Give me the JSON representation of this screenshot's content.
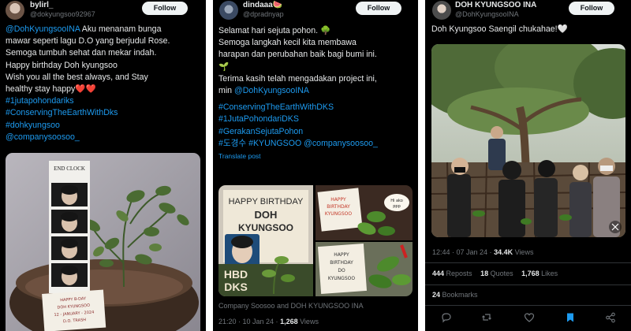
{
  "post1": {
    "display_name": "bylirl_",
    "handle": "@dokyungsoo92967",
    "follow_label": "Follow",
    "mention": "@DohKyungsooINA",
    "lines": [
      " Aku menanam bunga",
      "mawar seperti lagu D.O yang berjudul Rose.",
      "Semoga tumbuh sehat dan mekar indah.",
      "Happy birthday Doh kyungsoo",
      "Wish you all the best always, and Stay",
      "healthy stay happy"
    ],
    "hearts": "❤️❤️",
    "hashtags": [
      "#1jutapohondariks",
      "#ConservingTheEarthWithDks",
      "#dohkyungsoo",
      "@companysoosoo_"
    ],
    "photo": {
      "frame_title": "END CLOCK",
      "card_lines": [
        "HAPPY B-DAY",
        "DOH KYUNGSOO",
        "12 - JANUARY - 2024",
        "D.O. TRASH"
      ]
    }
  },
  "post2": {
    "display_name": "dindaaa",
    "display_emoji": "🍉",
    "handle": "@dpradnyap",
    "follow_label": "Follow",
    "lines": [
      "Selamat hari sejuta pohon. 🌳",
      "Semoga langkah kecil kita membawa",
      "harapan dan perubahan baik bagi bumi ini.",
      "🌱",
      "Terima kasih telah mengadakan project ini,"
    ],
    "min_text": "min ",
    "mention": "@DohKyungsooINA",
    "hashtags": [
      "#ConservingTheEarthWithDKS",
      "#1JutaPohondariDKS",
      "#GerakanSejutaPohon"
    ],
    "last_tags": "#도경수 #KYUNGSOO @companysoosoo_",
    "translate": "Translate post",
    "photo": {
      "card_left": [
        "HAPPY BIRTHDAY",
        "DOH",
        "KYUNGSOO"
      ],
      "hbd": [
        "HBD",
        "DKS"
      ],
      "card_top_right": [
        "HAPPY",
        "BIRTHDAY",
        "KYUNGSOO"
      ],
      "bubble": [
        "Hi ako",
        "ppp"
      ],
      "card_bottom_right": [
        "HAPPY",
        "BIRTHDAY",
        "DO",
        "KYUNGSOO"
      ]
    },
    "caption": "Company Soosoo and DOH KYUNGSOO INA",
    "time": "21:20 · 10 Jan 24 · ",
    "views_count": "1,268",
    "views_label": " Views"
  },
  "post3": {
    "display_name": "DOH KYUNGSOO INA",
    "handle": "@DohKyungsooINA",
    "follow_label": "Follow",
    "text": "Doh Kyungsoo Saengil chukahae!🤍",
    "time": "12:44 · 07 Jan 24 · ",
    "views_count": "34.4K",
    "views_label": " Views",
    "reposts_count": "444",
    "reposts_label": " Reposts",
    "quotes_count": "18",
    "quotes_label": " Quotes",
    "likes_count": "1,768",
    "likes_label": " Likes",
    "bookmarks_count": "24",
    "bookmarks_label": " Bookmarks",
    "icons": [
      "reply-icon",
      "repost-icon",
      "like-icon",
      "bookmark-icon",
      "share-icon"
    ]
  },
  "colors": {
    "background": "#000000",
    "text": "#e7e9ea",
    "secondary": "#71767b",
    "link": "#1d9bf0",
    "divider": "#2f3336",
    "follow_bg": "#eff3f4",
    "heart": "#f4212e"
  }
}
